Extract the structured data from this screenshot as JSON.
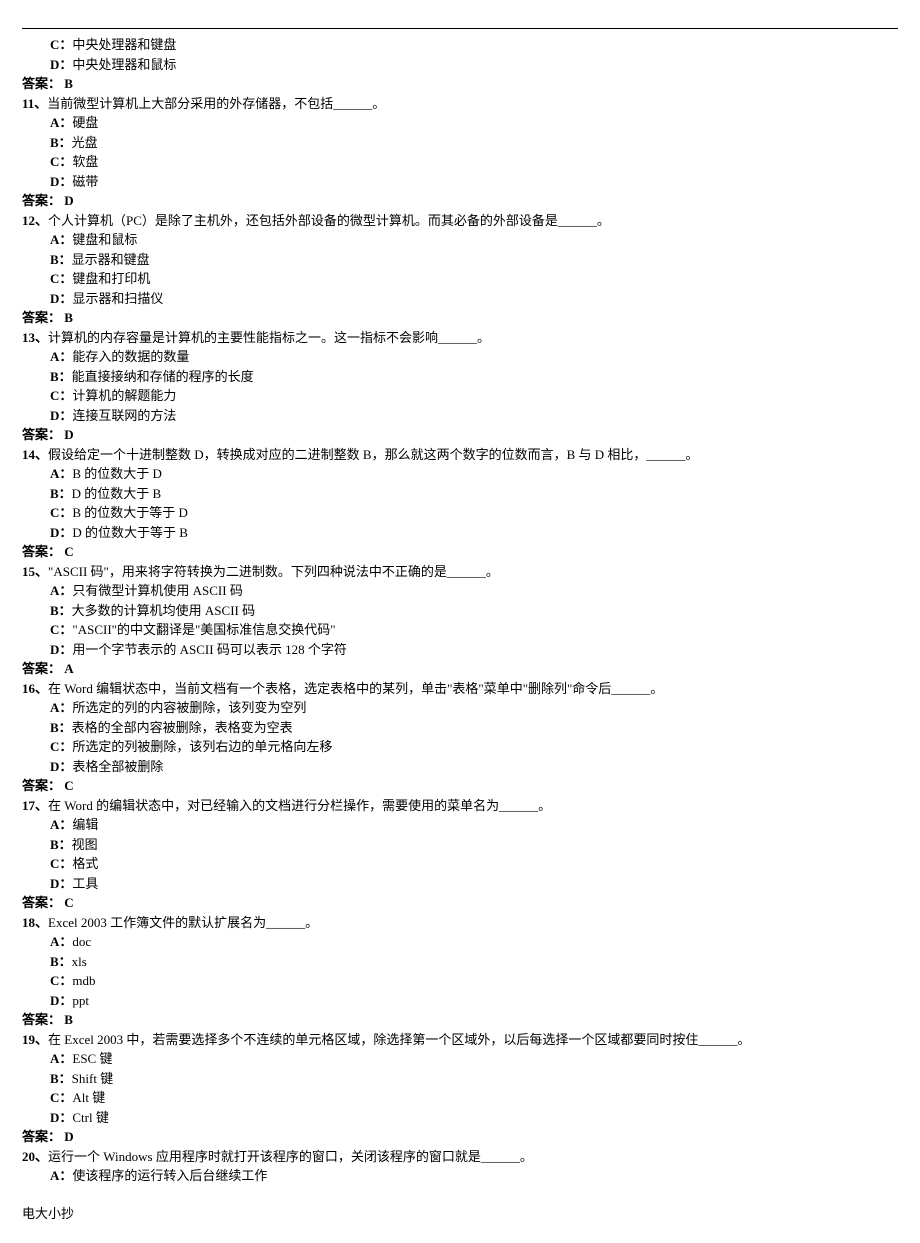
{
  "topOptions": [
    {
      "label": "C：",
      "text": "中央处理器和键盘"
    },
    {
      "label": "D：",
      "text": "中央处理器和鼠标"
    }
  ],
  "topAnswer": {
    "label": "答案：",
    "value": "B"
  },
  "questions": [
    {
      "num": "11、",
      "text": "当前微型计算机上大部分采用的外存储器，不包括______。",
      "options": [
        {
          "label": "A：",
          "text": "硬盘"
        },
        {
          "label": "B：",
          "text": "光盘"
        },
        {
          "label": "C：",
          "text": "软盘"
        },
        {
          "label": "D：",
          "text": "磁带"
        }
      ],
      "answer": {
        "label": "答案：",
        "value": "D"
      }
    },
    {
      "num": "12、",
      "text": "个人计算机（PC）是除了主机外，还包括外部设备的微型计算机。而其必备的外部设备是______。",
      "options": [
        {
          "label": "A：",
          "text": "键盘和鼠标"
        },
        {
          "label": "B：",
          "text": "显示器和键盘"
        },
        {
          "label": "C：",
          "text": "键盘和打印机"
        },
        {
          "label": "D：",
          "text": "显示器和扫描仪"
        }
      ],
      "answer": {
        "label": "答案：",
        "value": "B"
      }
    },
    {
      "num": "13、",
      "text": "计算机的内存容量是计算机的主要性能指标之一。这一指标不会影响______。",
      "options": [
        {
          "label": "A：",
          "text": "能存入的数据的数量"
        },
        {
          "label": "B：",
          "text": "能直接接纳和存储的程序的长度"
        },
        {
          "label": "C：",
          "text": "计算机的解题能力"
        },
        {
          "label": "D：",
          "text": "连接互联网的方法"
        }
      ],
      "answer": {
        "label": "答案：",
        "value": "D"
      }
    },
    {
      "num": "14、",
      "text": "假设给定一个十进制整数 D，转换成对应的二进制整数 B，那么就这两个数字的位数而言，B 与 D 相比，______。",
      "options": [
        {
          "label": "A：",
          "text": "B 的位数大于 D"
        },
        {
          "label": "B：",
          "text": "D 的位数大于 B"
        },
        {
          "label": "C：",
          "text": "B 的位数大于等于 D"
        },
        {
          "label": "D：",
          "text": "D 的位数大于等于 B"
        }
      ],
      "answer": {
        "label": "答案：",
        "value": "C"
      }
    },
    {
      "num": "15、",
      "text": "\"ASCII 码\"，用来将字符转换为二进制数。下列四种说法中不正确的是______。",
      "options": [
        {
          "label": "A：",
          "text": "只有微型计算机使用 ASCII 码"
        },
        {
          "label": "B：",
          "text": "大多数的计算机均使用 ASCII 码"
        },
        {
          "label": "C：",
          "text": "\"ASCII\"的中文翻译是\"美国标准信息交换代码\""
        },
        {
          "label": "D：",
          "text": "用一个字节表示的 ASCII 码可以表示 128 个字符"
        }
      ],
      "answer": {
        "label": "答案：",
        "value": "A"
      }
    },
    {
      "num": "16、",
      "text": "在 Word 编辑状态中，当前文档有一个表格，选定表格中的某列，单击\"表格\"菜单中\"删除列\"命令后______。",
      "options": [
        {
          "label": "A：",
          "text": "所选定的列的内容被删除，该列变为空列"
        },
        {
          "label": "B：",
          "text": "表格的全部内容被删除，表格变为空表"
        },
        {
          "label": "C：",
          "text": "所选定的列被删除，该列右边的单元格向左移"
        },
        {
          "label": "D：",
          "text": "表格全部被删除"
        }
      ],
      "answer": {
        "label": "答案：",
        "value": "C"
      }
    },
    {
      "num": "17、",
      "text": "在 Word 的编辑状态中，对已经输入的文档进行分栏操作，需要使用的菜单名为______。",
      "options": [
        {
          "label": "A：",
          "text": "编辑"
        },
        {
          "label": "B：",
          "text": "视图"
        },
        {
          "label": "C：",
          "text": "格式"
        },
        {
          "label": "D：",
          "text": "工具"
        }
      ],
      "answer": {
        "label": "答案：",
        "value": "C"
      }
    },
    {
      "num": "18、",
      "text": "Excel 2003 工作簿文件的默认扩展名为______。",
      "options": [
        {
          "label": "A：",
          "text": "doc"
        },
        {
          "label": "B：",
          "text": "xls"
        },
        {
          "label": "C：",
          "text": "mdb"
        },
        {
          "label": "D：",
          "text": "ppt"
        }
      ],
      "answer": {
        "label": "答案：",
        "value": "B"
      }
    },
    {
      "num": "19、",
      "text": "在 Excel 2003 中，若需要选择多个不连续的单元格区域，除选择第一个区域外，以后每选择一个区域都要同时按住______。",
      "options": [
        {
          "label": "A：",
          "text": "ESC 键"
        },
        {
          "label": "B：",
          "text": "Shift 键"
        },
        {
          "label": "C：",
          "text": "Alt 键"
        },
        {
          "label": "D：",
          "text": "Ctrl 键"
        }
      ],
      "answer": {
        "label": "答案：",
        "value": "D"
      }
    },
    {
      "num": "20、",
      "text": "运行一个 Windows 应用程序时就打开该程序的窗口，关闭该程序的窗口就是______。",
      "options": [
        {
          "label": "A：",
          "text": "使该程序的运行转入后台继续工作"
        }
      ]
    }
  ],
  "footer": "电大小抄"
}
